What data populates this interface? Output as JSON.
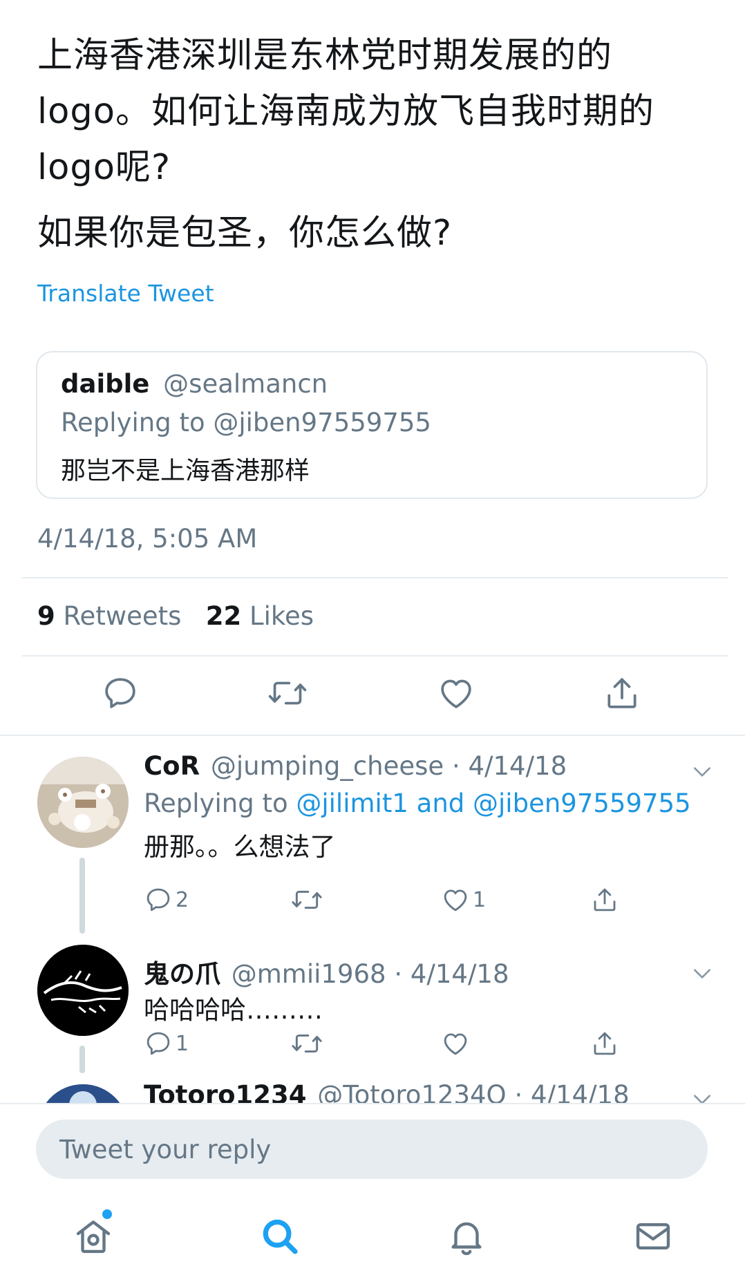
{
  "tweet": {
    "paragraph1": "上海香港深圳是东林党时期发展的的logo。如何让海南成为放飞自我时期的logo呢?",
    "paragraph2": "如果你是包圣，你怎么做?",
    "translate_label": "Translate Tweet",
    "quote": {
      "display_name": "daible",
      "handle": "@sealmancn",
      "replying_to": "Replying to @jiben97559755",
      "text": "那岂不是上海香港那样"
    },
    "timestamp": "4/14/18, 5:05 AM",
    "stats": {
      "retweets_count": "9",
      "retweets_label": "Retweets",
      "likes_count": "22",
      "likes_label": "Likes"
    },
    "actions": {
      "reply_icon": "reply-icon",
      "retweet_icon": "retweet-icon",
      "like_icon": "heart-icon",
      "share_icon": "share-icon"
    }
  },
  "replies": [
    {
      "display_name": "CoR",
      "handle": "@jumping_cheese",
      "date": "· 4/14/18",
      "replying_prefix": "Replying to",
      "replying_user1": "@jilimit1",
      "replying_and": "and",
      "replying_user2": "@jiben97559755",
      "text": "册那。。么想法了",
      "reply_count": "2",
      "retweet_count": "",
      "like_count": "1"
    },
    {
      "display_name": "鬼の爪",
      "handle": "@mmii1968",
      "date": "· 4/14/18",
      "text": "哈哈哈哈………",
      "reply_count": "1",
      "retweet_count": "",
      "like_count": ""
    },
    {
      "display_name": "Totoro1234",
      "handle": "@Totoro1234Q",
      "date": "· 4/14/18"
    }
  ],
  "composer": {
    "placeholder": "Tweet your reply"
  },
  "tabbar": {
    "home_icon": "home-icon",
    "search_icon": "search-icon",
    "notifications_icon": "bell-icon",
    "messages_icon": "mail-icon"
  },
  "colors": {
    "accent": "#1b95e0",
    "secondary_text": "#657786",
    "divider": "#e6ecf0"
  }
}
